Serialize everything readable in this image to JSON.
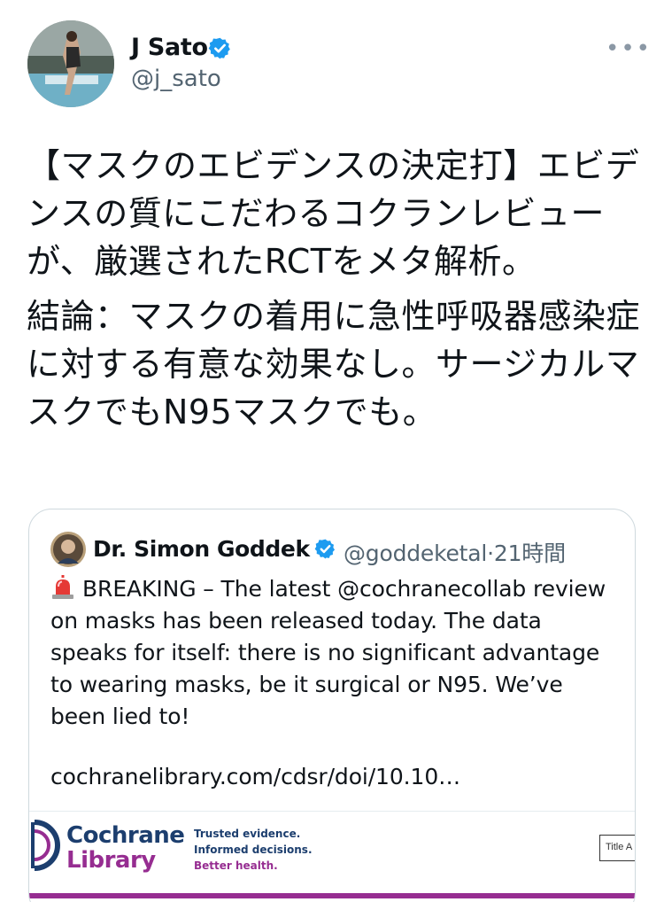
{
  "tweet": {
    "author_name": "J Sato",
    "author_handle": "@j_sato",
    "more_icon": "more-horizontal-icon",
    "paragraph_1": "【マスクのエビデンスの決定打】エビデンスの質にこだわるコクランレビューが、厳選されたRCTをメタ解析。",
    "paragraph_2": "結論：マスクの着用に急性呼吸器感染症に対する有意な効果なし。サージカルマスクでもN95マスクでも。"
  },
  "quote": {
    "author_name": "Dr. Simon Goddek",
    "author_handle": "@goddeketal",
    "separator": "·",
    "time_ago": "21時間",
    "text": "BREAKING – The latest @cochranecollab review on masks has been released today. The data speaks for itself: there is no significant advantage to wearing masks, be it surgical or N95. We’ve been lied to!",
    "link": "cochranelibrary.com/cdsr/doi/10.10…",
    "siren_icon": "siren-icon"
  },
  "card": {
    "logo_line1": "Cochrane",
    "logo_line2": "Library",
    "tagline_1": "Trusted evidence.",
    "tagline_2": "Informed decisions.",
    "tagline_3": "Better health.",
    "search_label": "Title A"
  },
  "colors": {
    "verified": "#1d9bf0",
    "muted": "#536471",
    "cochrane_blue": "#1c3e6e",
    "cochrane_purple": "#962d91"
  }
}
